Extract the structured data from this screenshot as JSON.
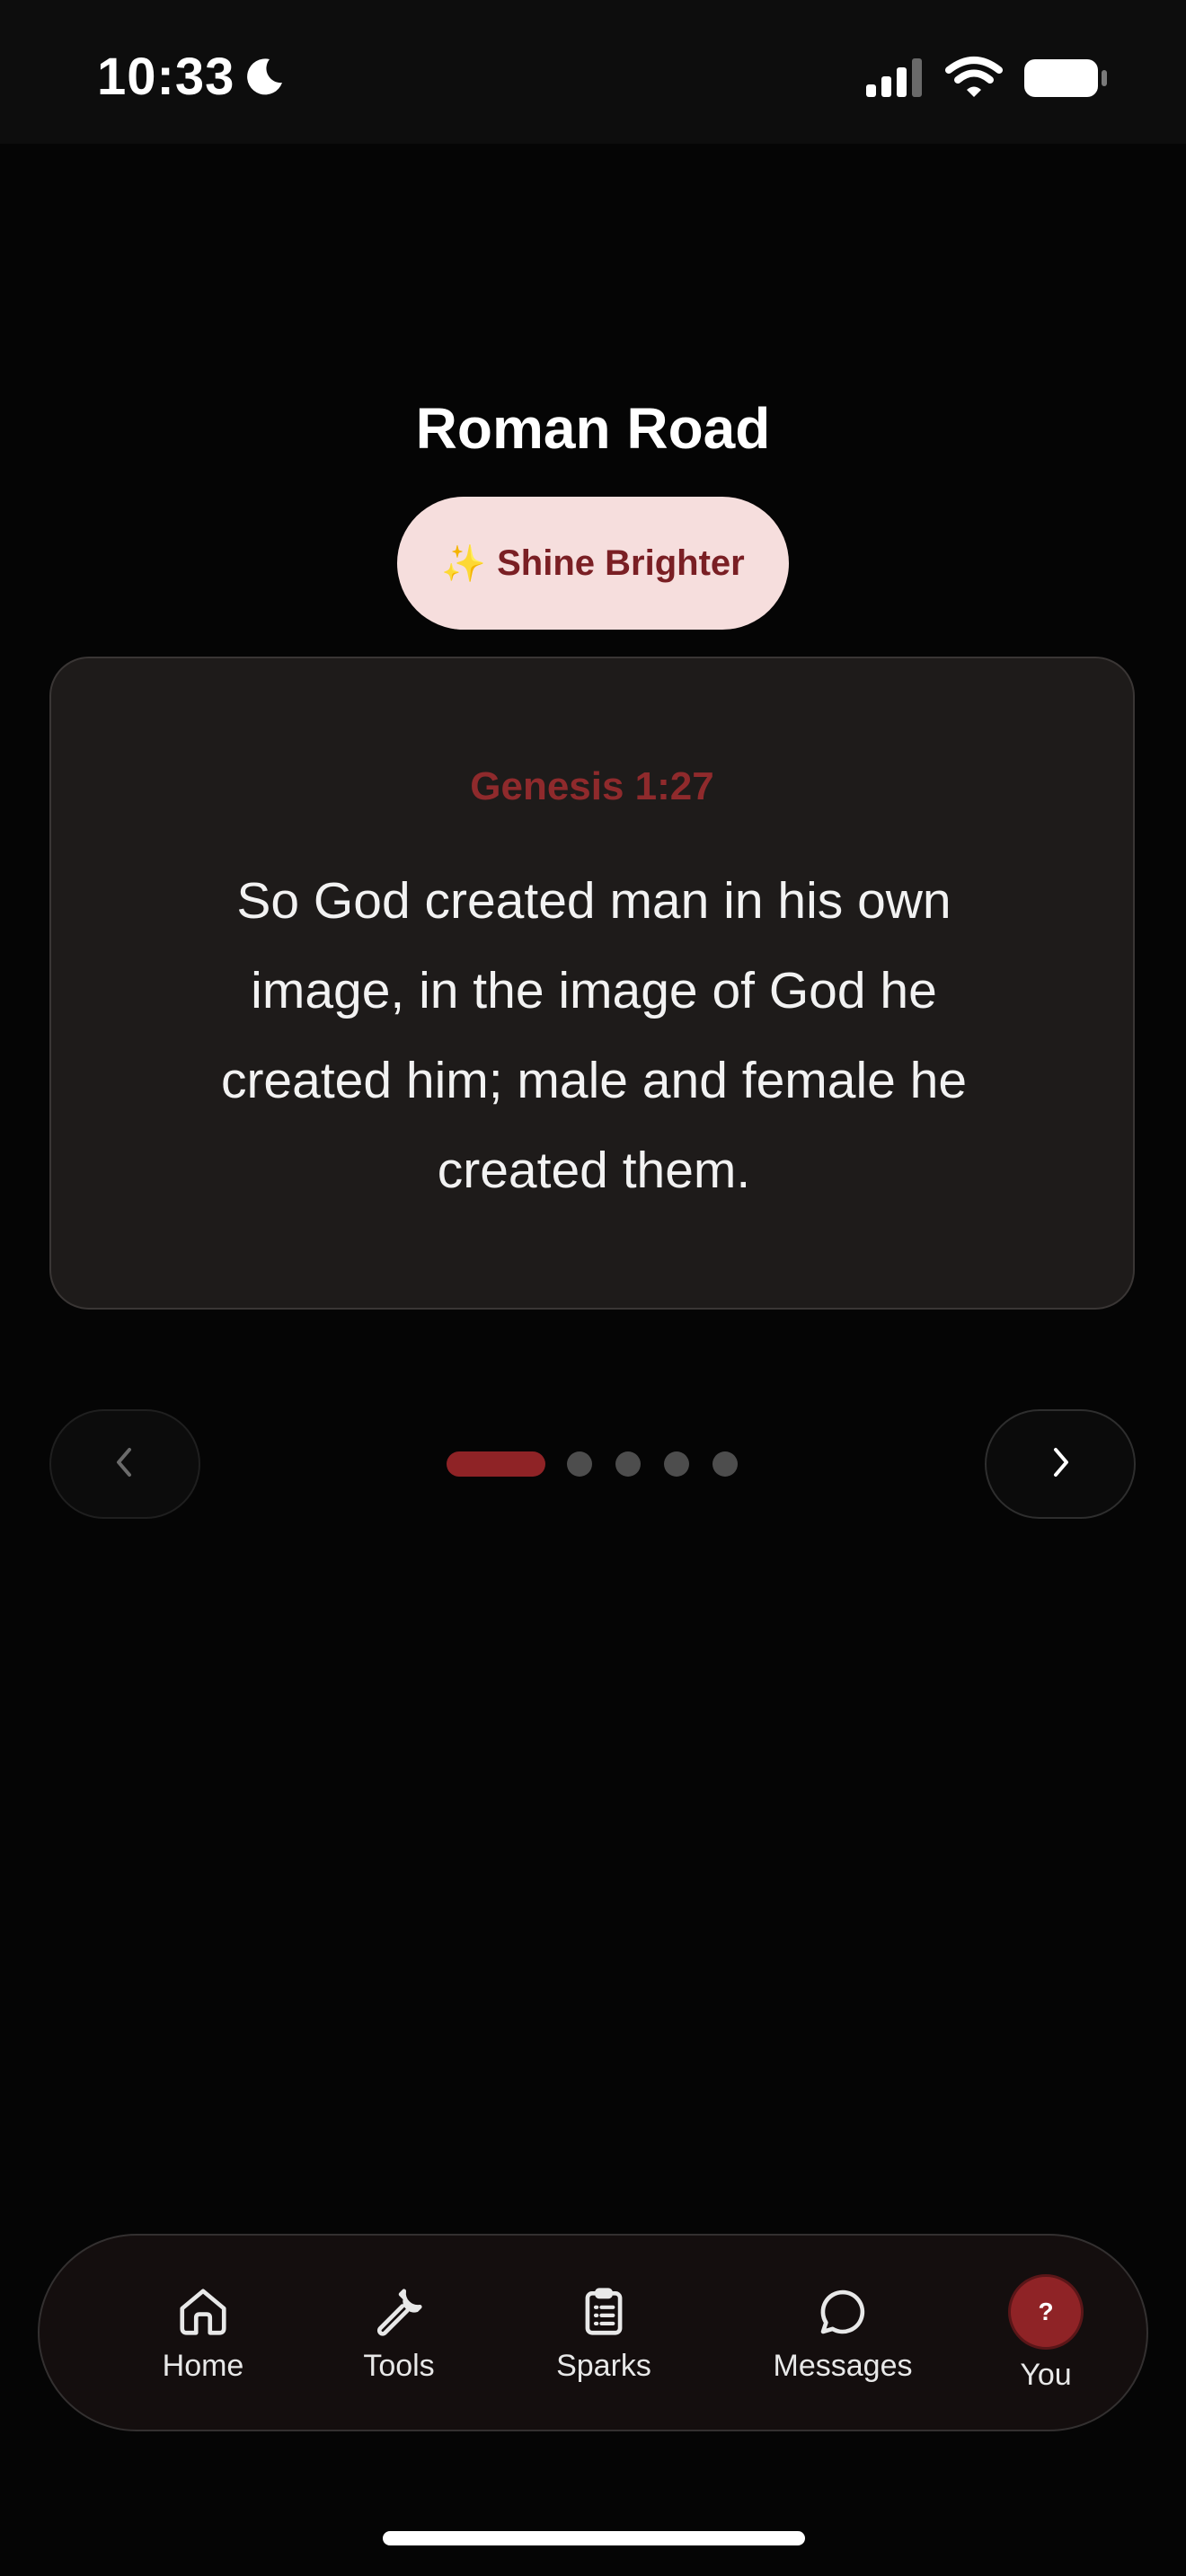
{
  "status_bar": {
    "time": "10:33"
  },
  "screen": {
    "title": "Roman Road"
  },
  "shine_button": {
    "emoji": "✨",
    "label": "Shine Brighter"
  },
  "verse_card": {
    "reference": "Genesis 1:27",
    "text": "So God created man in his own image, in the image of God he created him; male and female he created them."
  },
  "pagination": {
    "total_pages": 5,
    "current_page": 1
  },
  "tab_bar": {
    "tabs": [
      {
        "label": "Home",
        "icon": "home-icon"
      },
      {
        "label": "Tools",
        "icon": "wrench-icon"
      },
      {
        "label": "Sparks",
        "icon": "clipboard-icon"
      },
      {
        "label": "Messages",
        "icon": "chat-bubble-icon"
      },
      {
        "label": "You",
        "icon": "avatar",
        "avatar_text": "?"
      }
    ]
  },
  "colors": {
    "accent": "#8f2326",
    "pill_bg": "#f6dedd",
    "card_bg": "#1e1b1a"
  }
}
